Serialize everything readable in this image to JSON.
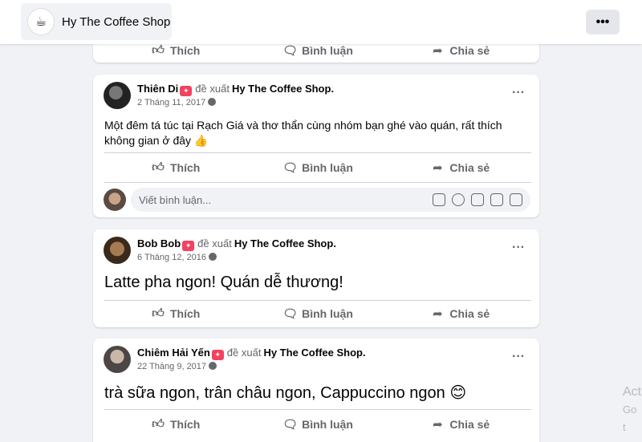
{
  "header": {
    "page_name": "Hy The Coffee Shop",
    "more_label": "•••"
  },
  "top_card": {
    "actions": {
      "like": "Thích",
      "comment": "Bình luận",
      "share": "Chia sẻ"
    }
  },
  "posts": [
    {
      "author": "Thiên Di",
      "verb": "đề xuất",
      "page": "Hy The Coffee Shop.",
      "date": "2 Tháng 11, 2017",
      "text": "Một đêm tá túc tại Rạch Giá và thơ thẩn cùng nhóm bạn ghé vào quán, rất thích không gian ở đây 👍",
      "actions": {
        "like": "Thích",
        "comment": "Bình luận",
        "share": "Chia sẻ"
      },
      "comment_placeholder": "Viết bình luận..."
    },
    {
      "author": "Bob Bob",
      "verb": "đề xuất",
      "page": "Hy The Coffee Shop.",
      "date": "6 Tháng 12, 2016",
      "text": "Latte pha ngon! Quán dễ thương!",
      "actions": {
        "like": "Thích",
        "comment": "Bình luận",
        "share": "Chia sẻ"
      }
    },
    {
      "author": "Chiêm Hải Yến",
      "verb": "đề xuất",
      "page": "Hy The Coffee Shop.",
      "date": "22 Tháng 9, 2017",
      "text": "trà sữa ngon, trân châu ngon, Cappuccino ngon 😊",
      "actions": {
        "like": "Thích",
        "comment": "Bình luận",
        "share": "Chia sẻ"
      }
    }
  ],
  "icons": {
    "like": "thumbs-up-icon",
    "comment": "comment-icon",
    "share": "share-arrow-icon",
    "privacy": "globe-icon",
    "badge": "recommend-badge-icon"
  },
  "colors": {
    "badge": "#f3425f",
    "secondary_text": "#65676b",
    "background": "#f0f2f5"
  },
  "watermark": {
    "line1": "Act",
    "line2": "Go t"
  }
}
